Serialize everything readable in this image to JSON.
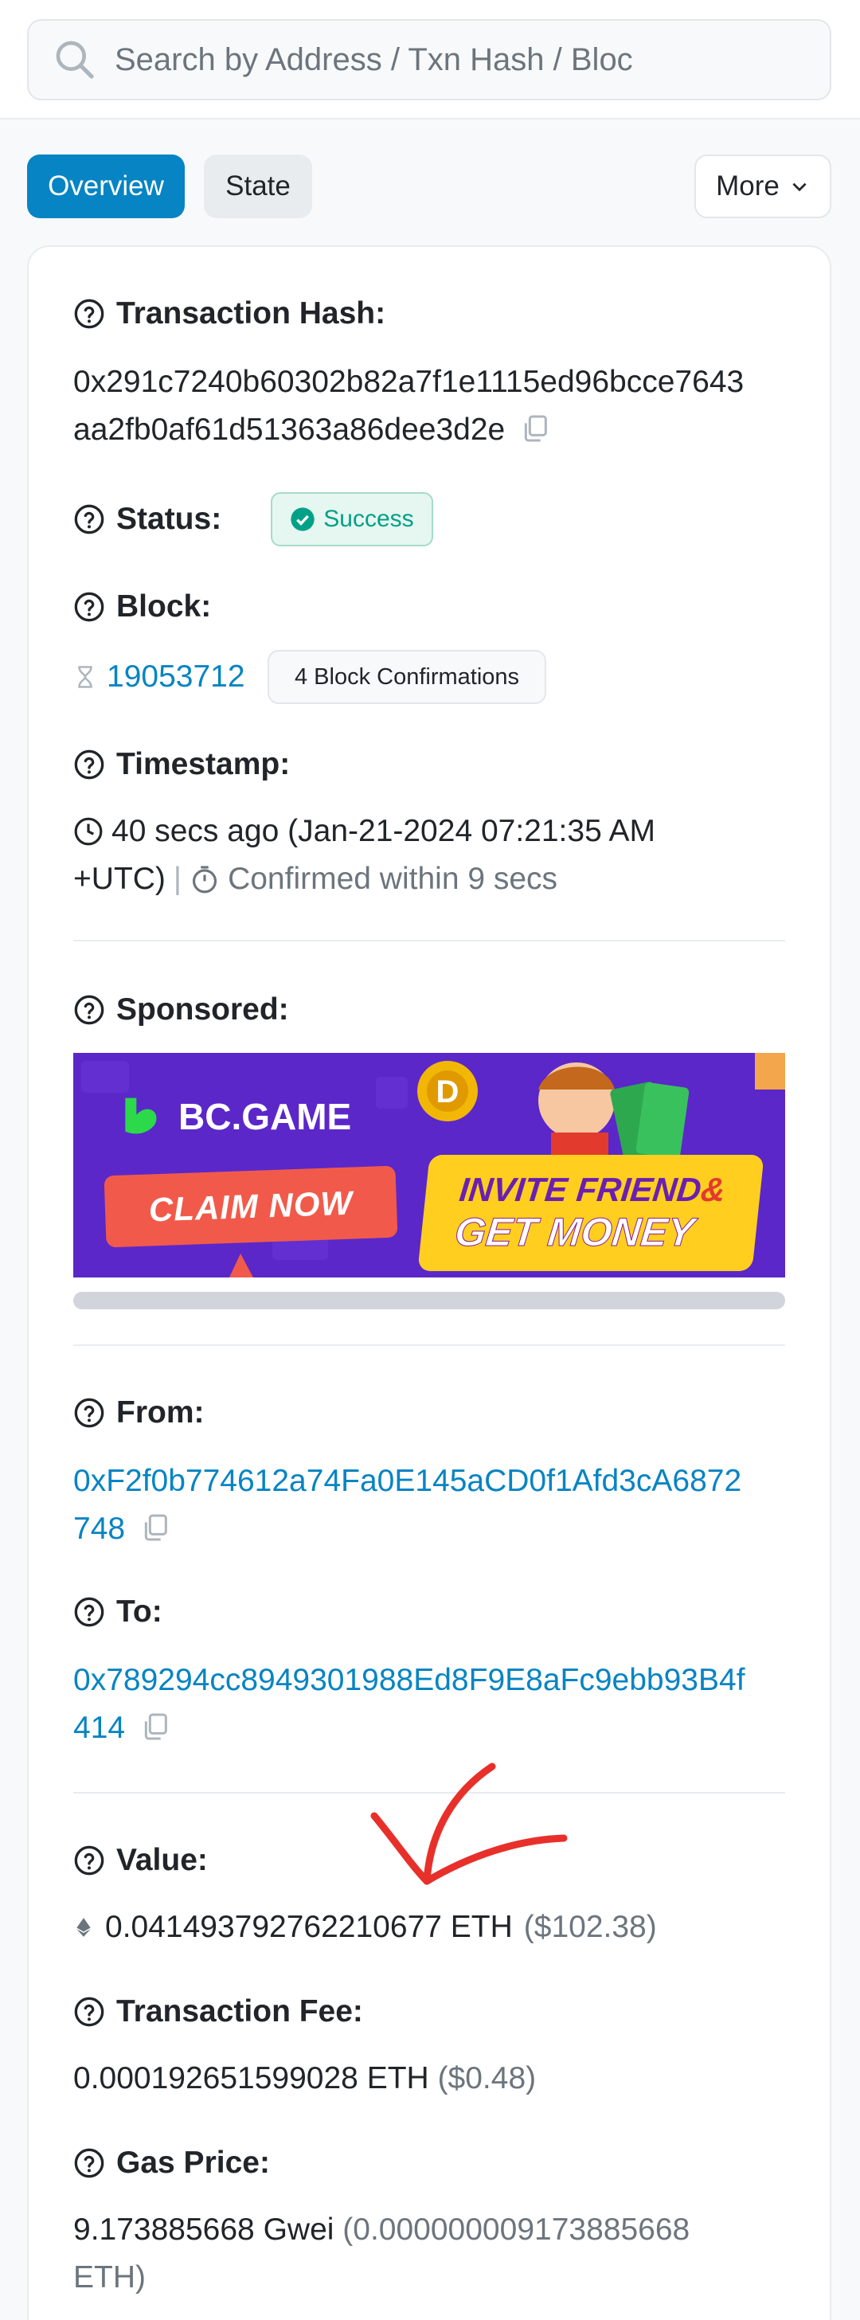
{
  "search": {
    "placeholder": "Search by Address / Txn Hash / Bloc"
  },
  "tabs": {
    "overview": "Overview",
    "state": "State",
    "more": "More"
  },
  "fields": {
    "tx_hash": {
      "label": "Transaction Hash:",
      "value_line1": "0x291c7240b60302b82a7f1e1115ed96bcce7643",
      "value_line2": "aa2fb0af61d51363a86dee3d2e"
    },
    "status": {
      "label": "Status:",
      "value": "Success"
    },
    "block": {
      "label": "Block:",
      "number": "19053712",
      "confirmations": "4 Block Confirmations"
    },
    "timestamp": {
      "label": "Timestamp:",
      "line1": "40 secs ago (Jan-21-2024 07:21:35 AM",
      "line2_a": "+UTC)",
      "separator": "|",
      "line2_b": "Confirmed within 9 secs"
    },
    "sponsored": {
      "label": "Sponsored:"
    },
    "from": {
      "label": "From:",
      "line1": "0xF2f0b774612a74Fa0E145aCD0f1Afd3cA6872",
      "line2": "748"
    },
    "to": {
      "label": "To:",
      "line1": "0x789294cc8949301988Ed8F9E8aFc9ebb93B4f",
      "line2": "414"
    },
    "value": {
      "label": "Value:",
      "amount": "0.041493792762210677 ETH",
      "usd": "($102.38)"
    },
    "fee": {
      "label": "Transaction Fee:",
      "amount": "0.000192651599028 ETH",
      "usd": "($0.48)"
    },
    "gas": {
      "label": "Gas Price:",
      "amount": "9.173885668 Gwei",
      "eth_line1": "(0.000000009173885668",
      "eth_line2": "ETH)"
    }
  },
  "ad": {
    "brand": "BC.GAME",
    "claim": "CLAIM NOW",
    "invite_line1": "INVITE FRIEND",
    "amp": "&",
    "invite_line2": "GET MONEY"
  },
  "colors": {
    "link": "#0784c3",
    "success": "#00a186",
    "annotation": "#e8302a",
    "ad_bg": "#5b27c9"
  }
}
